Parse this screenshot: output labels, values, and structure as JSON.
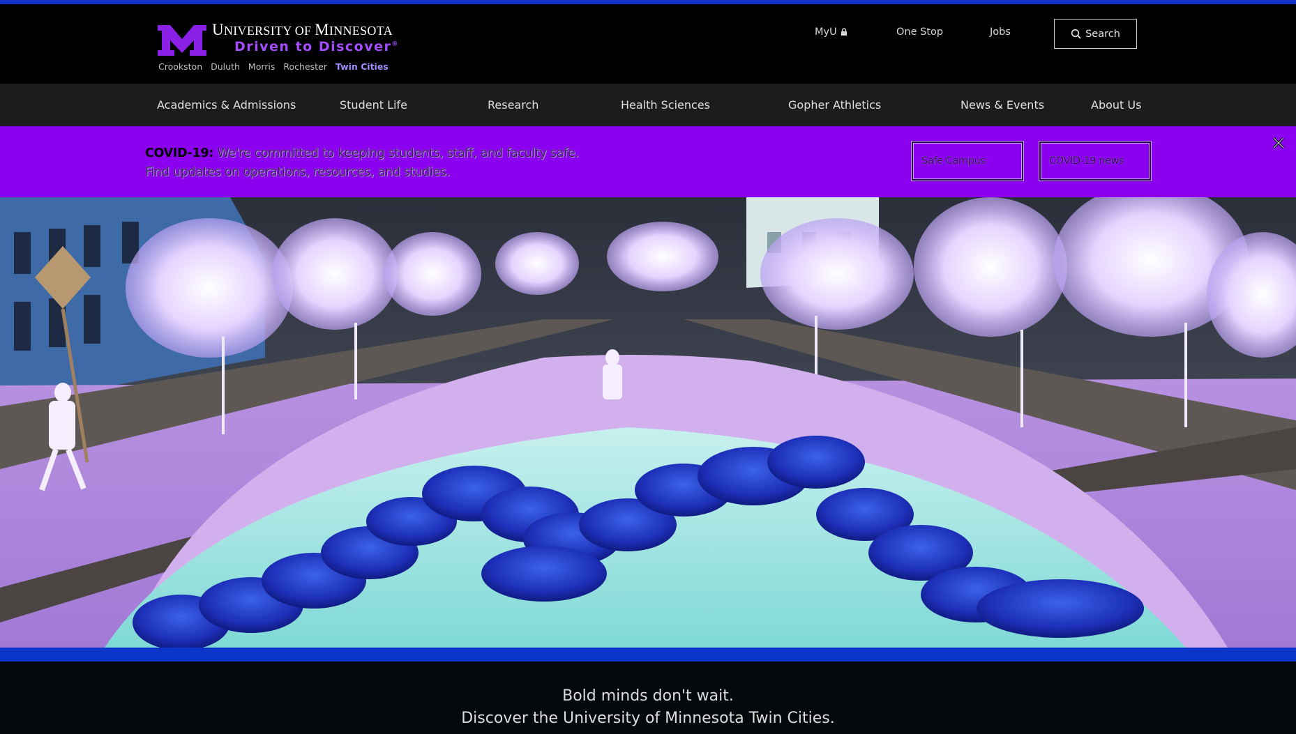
{
  "header": {
    "university_name_first": "U",
    "university_name_rest": "niversity of ",
    "university_name_second": "M",
    "university_name_rest2": "innesota",
    "tagline": "Driven to Discover",
    "tagline_mark": "®",
    "campuses": [
      "Crookston",
      "Duluth",
      "Morris",
      "Rochester",
      "Twin Cities"
    ],
    "current_campus": "Twin Cities",
    "utility_links": {
      "myu": "MyU",
      "one_stop": "One Stop",
      "jobs": "Jobs"
    },
    "search_label": "Search"
  },
  "nav": {
    "items": [
      "Academics & Admissions",
      "Student Life",
      "Research",
      "Health Sciences",
      "Gopher Athletics",
      "News & Events",
      "About Us"
    ]
  },
  "alert": {
    "lead": "COVID-19:",
    "text_line1": " We're committed to keeping students, staff, and faculty safe.",
    "text_line2": "Find updates on operations, resources, and studies.",
    "button1": "Safe Campus",
    "button2": "COVID-19 news"
  },
  "tagline_section": {
    "line1": "Bold minds don't wait.",
    "line2": "Discover the University of Minnesota Twin Cities."
  },
  "colors": {
    "accent_top": "#1133cc",
    "alert_bg": "#8b00ee",
    "tagline_color": "#a44dff",
    "band": "#0b35c8"
  },
  "icons": {
    "logo": "block-m-logo",
    "lock": "lock-icon",
    "search": "search-icon",
    "close": "close-icon"
  }
}
